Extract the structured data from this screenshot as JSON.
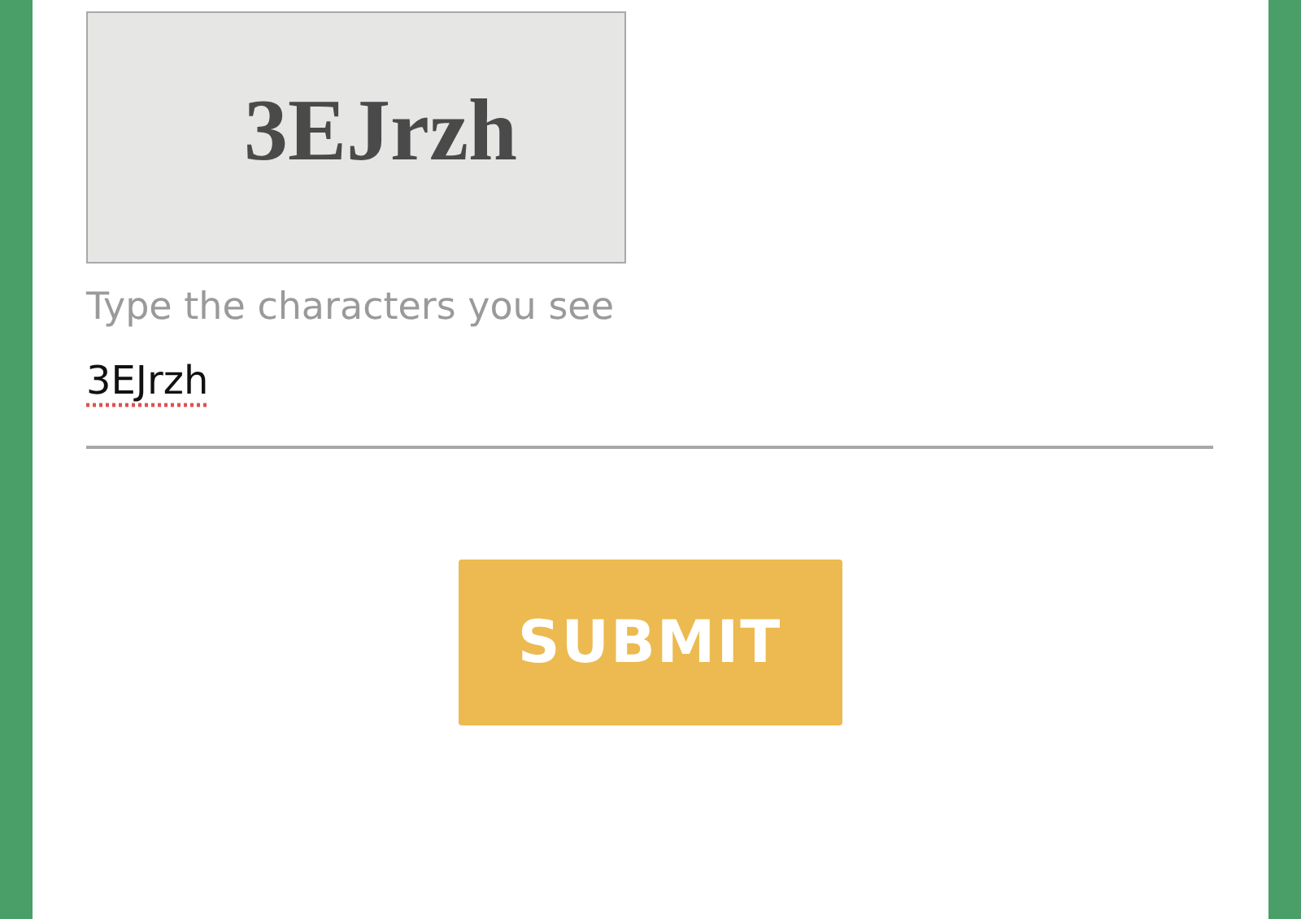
{
  "captcha": {
    "text": "3EJrzh"
  },
  "field": {
    "label": "Type the characters you see",
    "value": "3EJrzh",
    "misspelled": true
  },
  "buttons": [
    {
      "label": "SUBMIT"
    }
  ]
}
